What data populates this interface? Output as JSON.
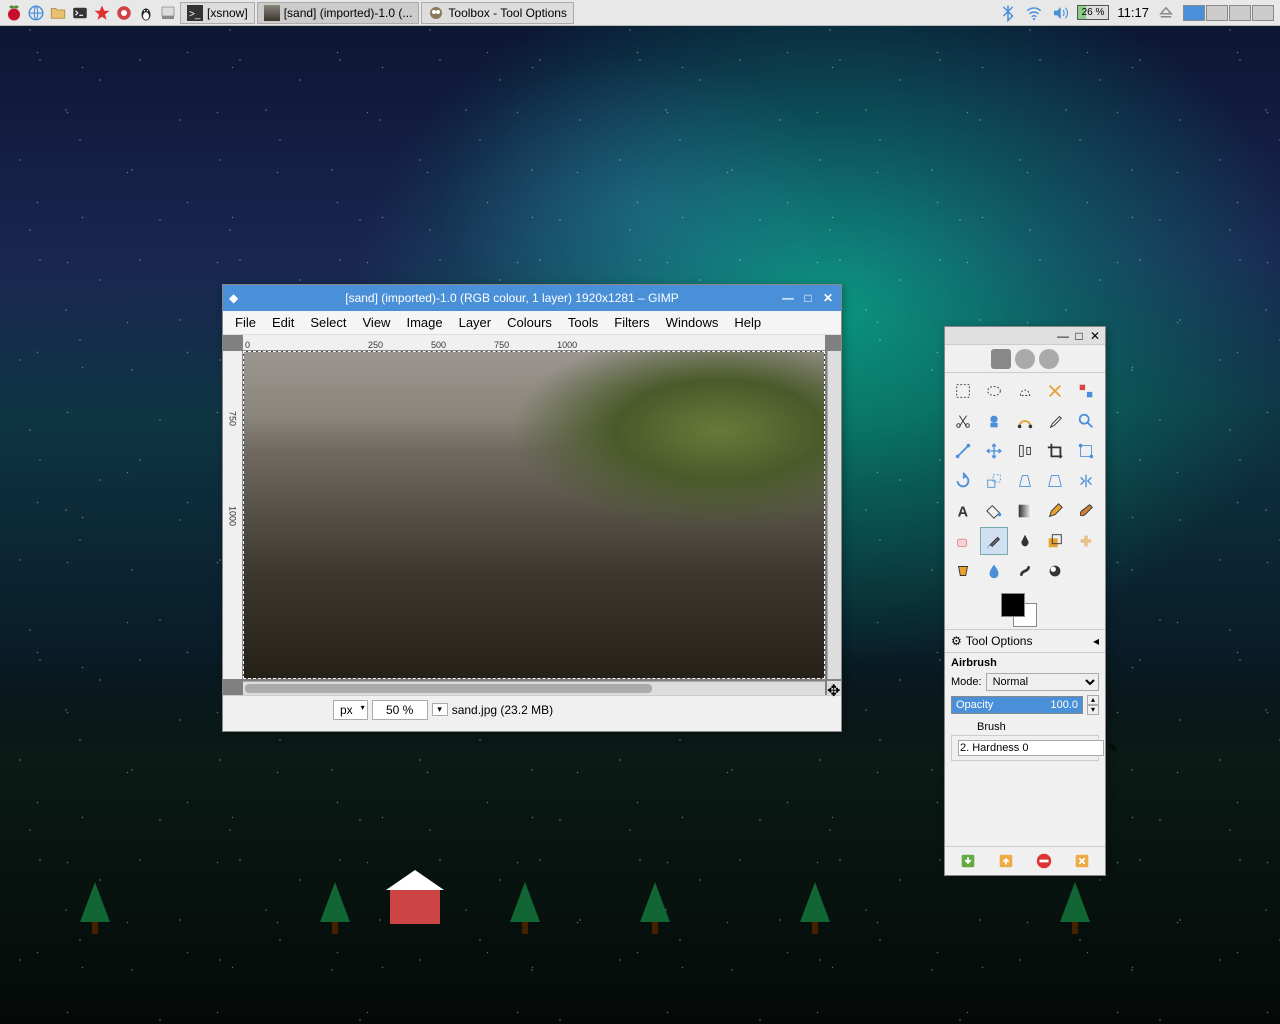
{
  "taskbar": {
    "items": [
      {
        "label": "[xsnow]"
      },
      {
        "label": "[sand] (imported)-1.0 (..."
      },
      {
        "label": "Toolbox - Tool Options"
      }
    ],
    "battery": "26 %",
    "clock": "11:17"
  },
  "gimp": {
    "title": "[sand] (imported)-1.0 (RGB colour, 1 layer) 1920x1281 – GIMP",
    "menu": [
      "File",
      "Edit",
      "Select",
      "View",
      "Image",
      "Layer",
      "Colours",
      "Tools",
      "Filters",
      "Windows",
      "Help"
    ],
    "ruler_h": [
      "0",
      "250",
      "500",
      "750",
      "1000"
    ],
    "ruler_v_marks": [
      "750",
      "1000"
    ],
    "status": {
      "unit": "px",
      "zoom": "50 %",
      "file": "sand.jpg (23.2 MB)"
    }
  },
  "toolbox": {
    "options_label": "Tool Options",
    "tool_name": "Airbrush",
    "mode_label": "Mode:",
    "mode_value": "Normal",
    "opacity_label": "Opacity",
    "opacity_value": "100.0",
    "brush_label": "Brush",
    "brush_value": "2. Hardness 0"
  }
}
